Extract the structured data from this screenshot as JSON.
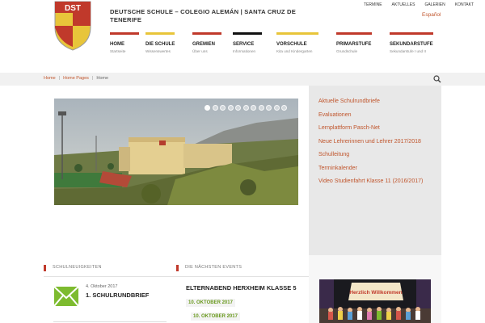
{
  "header": {
    "logo_text": "DST",
    "site_title": "Deutsche Schule – Colegio Alemán | Santa Cruz de Tenerife",
    "top_links": [
      "Termine",
      "Aktuelles",
      "Galerien",
      "Kontakt"
    ],
    "language": "Español",
    "nav": [
      {
        "label": "Home",
        "sub": "Startseite",
        "color": "#c0392b"
      },
      {
        "label": "Die Schule",
        "sub": "Wissenswertes",
        "color": "#e8c53a"
      },
      {
        "label": "Gremien",
        "sub": "Über uns",
        "color": "#c0392b"
      },
      {
        "label": "Service",
        "sub": "Informationen",
        "color": "#111111"
      },
      {
        "label": "Vorschule",
        "sub": "Kita und Kindergarten",
        "color": "#e8c53a"
      },
      {
        "label": "Primarstufe",
        "sub": "Grundschule",
        "color": "#c0392b"
      },
      {
        "label": "Sekundarstufe",
        "sub": "Sekundarstufe I und II",
        "color": "#c0392b"
      }
    ]
  },
  "breadcrumb": {
    "items": [
      "Home",
      "Home Pages",
      "Home"
    ]
  },
  "slider": {
    "dot_count": 11,
    "active_index": 0
  },
  "sidebar": {
    "links": [
      "Aktuelle Schulrundbriefe",
      "Evaluationen",
      "Lernplattform Pasch-Net",
      "Neue Lehrerinnen und Lehrer 2017/2018",
      "Schulleitung",
      "Terminkalender",
      "Video Studienfahrt Klasse 11 (2016/2017)"
    ]
  },
  "news": {
    "heading": "Schulneuigkeiten",
    "date": "4. Oktober 2017",
    "title": "1. Schulrundbrief"
  },
  "events": {
    "heading": "Die nächsten Events",
    "title": "Elternabend Herxheim Klasse 5",
    "date1": "10. Oktober 2017",
    "date2": "10. Oktober 2017"
  },
  "gallery": {
    "banner_text": "Herzlich Willkommen"
  },
  "colors": {
    "accent": "#c0552c",
    "brand_red": "#c0392b",
    "brand_yellow": "#e8c53a",
    "event_green": "#6a9a1f"
  }
}
